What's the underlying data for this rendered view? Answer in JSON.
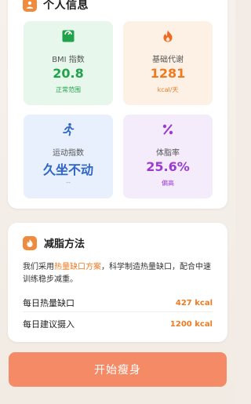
{
  "profile_card": {
    "title": "个人信息",
    "metrics": [
      {
        "icon": "scale-icon",
        "label": "BMI 指数",
        "value": "20.8",
        "sub": "正常范围",
        "color": "#22a24a"
      },
      {
        "icon": "flame-icon",
        "label": "基础代谢",
        "value": "1281",
        "sub": "kcal/天",
        "color": "#ee7a22"
      },
      {
        "icon": "running-icon",
        "label": "运动指数",
        "value": "久坐不动",
        "sub": "--",
        "color": "#2f66c6"
      },
      {
        "icon": "percent-icon",
        "label": "体脂率",
        "value": "25.6%",
        "sub": "偏高",
        "color": "#9b3bd0"
      }
    ]
  },
  "plan_card": {
    "title": "减脂方法",
    "icon": "flame-icon",
    "desc_prefix": "我们采用",
    "desc_highlight": "热量缺口方案",
    "desc_suffix": "，科学制造热量缺口，配合中速训练稳步减重。",
    "rows": [
      {
        "label": "每日热量缺口",
        "value": "427 kcal"
      },
      {
        "label": "每日建议摄入",
        "value": "1200 kcal"
      }
    ]
  },
  "start_button": {
    "label": "开始瘦身"
  },
  "colors": {
    "accent": "#f08a3c",
    "button": "#f48b66",
    "highlight": "#ee7a22"
  }
}
